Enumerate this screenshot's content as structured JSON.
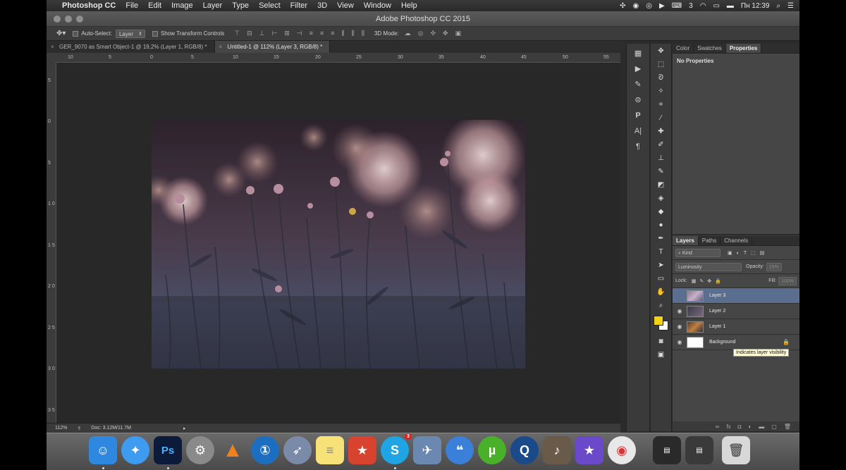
{
  "menubar": {
    "app_name": "Photoshop CC",
    "items": [
      "File",
      "Edit",
      "Image",
      "Layer",
      "Type",
      "Select",
      "Filter",
      "3D",
      "View",
      "Window",
      "Help"
    ],
    "keyboard": "3",
    "clock": "Пн 12:39"
  },
  "window": {
    "title": "Adobe Photoshop CC 2015"
  },
  "options": {
    "auto_select_label": "Auto-Select:",
    "auto_select_value": "Layer",
    "transform_label": "Show Transform Controls",
    "mode_label": "3D Mode:"
  },
  "tabs": [
    {
      "label": "GER_9070 as Smart Object-1 @ 19,2% (Layer 1, RGB/8) *",
      "active": false
    },
    {
      "label": "Untitled-1 @ 112% (Layer 3, RGB/8) *",
      "active": true
    }
  ],
  "ruler": {
    "h_ticks": [
      "10",
      "5",
      "0",
      "5",
      "10",
      "15",
      "20",
      "25",
      "30",
      "35",
      "40",
      "45",
      "50",
      "55"
    ],
    "v_ticks": [
      "5",
      "0",
      "5",
      "1 0",
      "1 5",
      "2 0",
      "2 5",
      "3 0",
      "3 5"
    ]
  },
  "status": {
    "zoom": "112%",
    "doc": "Doc: 3.12M/11.7M"
  },
  "panels": {
    "top_tabs": [
      "Color",
      "Swatches",
      "Properties"
    ],
    "properties_text": "No Properties",
    "layer_tabs": [
      "Layers",
      "Paths",
      "Channels"
    ],
    "filter_kind": "Kind",
    "blend_mode": "Luminosity",
    "opacity_label": "Opacity:",
    "opacity_value": "15%",
    "lock_label": "Lock:",
    "fill_label": "Fill:",
    "fill_value": "100%",
    "layers": [
      {
        "name": "Layer 3",
        "selected": true
      },
      {
        "name": "Layer 2",
        "selected": false
      },
      {
        "name": "Layer 1",
        "selected": false
      },
      {
        "name": "Background",
        "selected": false,
        "locked": true
      }
    ],
    "tooltip": "Indicates layer visibility"
  },
  "colors": {
    "foreground": "#f5d310",
    "background": "#ffffff",
    "selection": "#5a6f8f"
  },
  "dock": {
    "apps": [
      "finder",
      "safari",
      "photoshop",
      "system-preferences",
      "vlc",
      "1password",
      "launchpad",
      "notes",
      "wunderlist",
      "skype",
      "preview",
      "messages",
      "utorrent",
      "quicktime",
      "garageband",
      "imovie",
      "chrome",
      "window-1",
      "window-2",
      "trash"
    ],
    "skype_badge": "3"
  }
}
